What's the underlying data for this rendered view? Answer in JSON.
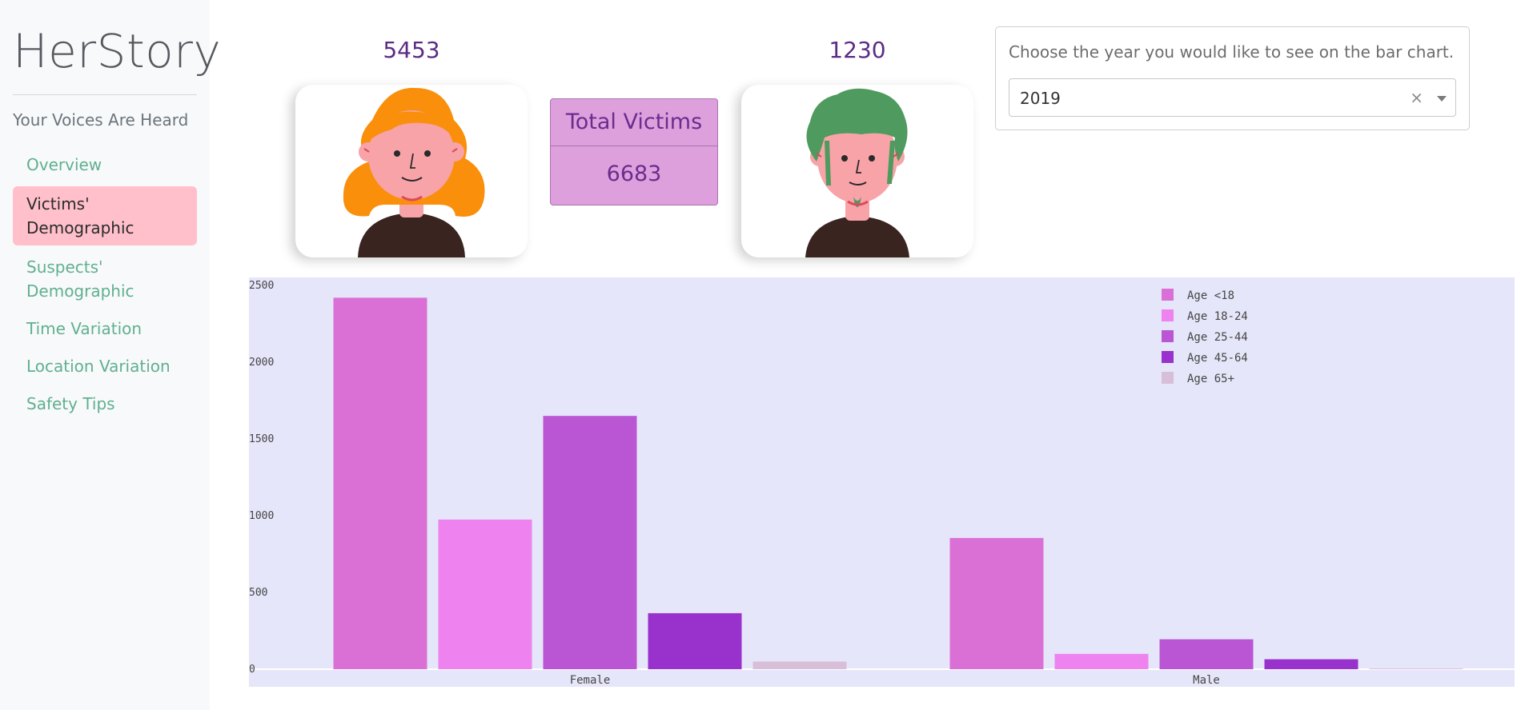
{
  "sidebar": {
    "brand": "HerStory",
    "tagline": "Your Voices Are Heard",
    "items": [
      {
        "label": "Overview"
      },
      {
        "label": "Victims' Demographic"
      },
      {
        "label": "Suspects' Demographic"
      },
      {
        "label": "Time Variation"
      },
      {
        "label": "Location Variation"
      },
      {
        "label": "Safety Tips"
      }
    ],
    "active_index": 1
  },
  "stats": {
    "female_count": "5453",
    "male_count": "1230",
    "total_label": "Total Victims",
    "total_value": "6683"
  },
  "year_filter": {
    "prompt": "Choose the year you would like to see on the bar chart.",
    "selected": "2019",
    "clear_symbol": "×"
  },
  "colors": {
    "accent_text": "#5b2c83",
    "nav_link": "#5fb08f",
    "nav_active_bg": "#ffc0cb",
    "total_box_bg": "#dda0dd",
    "plot_bg": "#e6e6fa"
  },
  "chart_data": {
    "type": "bar",
    "title": "",
    "xlabel": "",
    "ylabel": "",
    "categories": [
      "Female",
      "Male"
    ],
    "series": [
      {
        "name": "Age <18",
        "color": "#da70d6",
        "values": [
          2420,
          855
        ]
      },
      {
        "name": "Age 18-24",
        "color": "#ee82ee",
        "values": [
          975,
          100
        ]
      },
      {
        "name": "Age 25-44",
        "color": "#ba55d3",
        "values": [
          1650,
          195
        ]
      },
      {
        "name": "Age 45-64",
        "color": "#9932cc",
        "values": [
          365,
          65
        ]
      },
      {
        "name": "Age 65+",
        "color": "#d8bfd8",
        "values": [
          50,
          5
        ]
      }
    ],
    "ylim": [
      0,
      2500
    ],
    "yticks": [
      "0",
      "500",
      "1000",
      "1500",
      "2000",
      "2500"
    ],
    "grid": false,
    "legend_position": "top-right"
  }
}
